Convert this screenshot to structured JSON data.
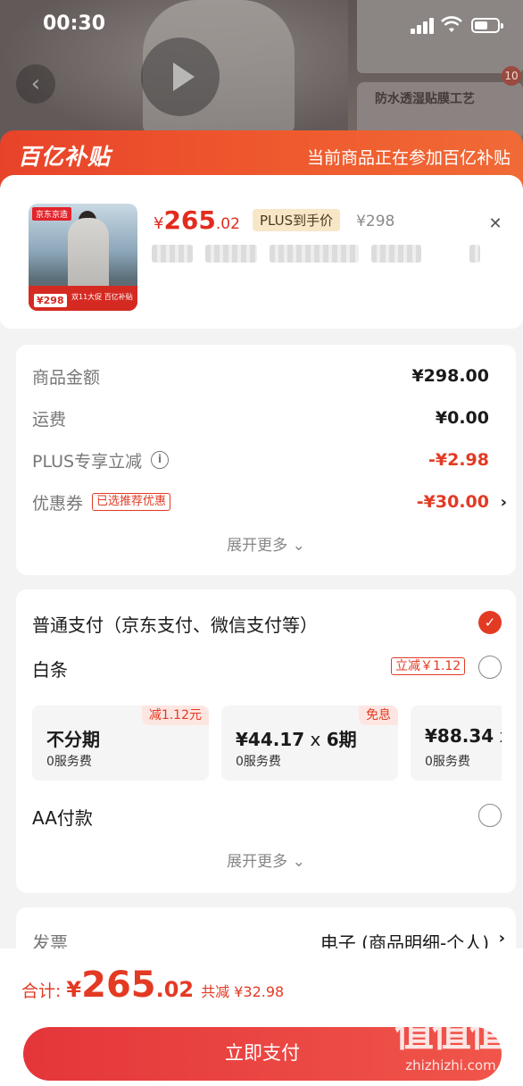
{
  "status_bar": {
    "time": "00:30"
  },
  "background_page": {
    "feature_text": "防水透湿贴膜工艺",
    "badge_count": "10"
  },
  "banner": {
    "logo": "百亿补贴",
    "text": "当前商品正在参加百亿补贴"
  },
  "product": {
    "image_store_tag": "京东京造",
    "image_price": "¥298",
    "image_promo": "双11大促 百亿补贴",
    "price_yen": "¥",
    "price_int": "265",
    "price_dec": ".02",
    "plus_tag": "PLUS到手价",
    "original_price": "¥298",
    "close_icon": "close-icon"
  },
  "amounts": {
    "goods_label": "商品金额",
    "goods_value": "¥298.00",
    "shipping_label": "运费",
    "shipping_value": "¥0.00",
    "plus_label": "PLUS专享立减",
    "plus_value": "-¥2.98",
    "coupon_label": "优惠券",
    "coupon_tag": "已选推荐优惠",
    "coupon_value": "-¥30.00",
    "expand_more": "展开更多"
  },
  "payment": {
    "normal_title": "普通支付（京东支付、微信支付等）",
    "baitiao_label": "白条",
    "baitiao_reduce": "立减￥1.12",
    "plans": [
      {
        "main": "不分期",
        "x": "",
        "periods": "",
        "sub": "0服务费",
        "badge": "减1.12元"
      },
      {
        "main": "¥44.17",
        "x": " x ",
        "periods": "6期",
        "sub": "0服务费",
        "badge": "免息"
      },
      {
        "main": "¥88.34",
        "x": " x",
        "periods": "",
        "sub": "0服务费",
        "badge": ""
      }
    ],
    "aa_label": "AA付款",
    "expand_more": "展开更多"
  },
  "invoice": {
    "label": "发票",
    "value": "电子 (商品明细-个人)"
  },
  "bottom": {
    "total_label": "合计:",
    "total_yen": "¥",
    "total_int": "265",
    "total_dec": ".02",
    "total_save": "共减 ¥32.98",
    "pay_button": "立即支付"
  },
  "watermark": {
    "logo": "值值值",
    "url": "zhizhizhi.com"
  },
  "colors": {
    "accent_red": "#e33a24",
    "banner_orange": "#ef5a2e",
    "plus_gold": "#f8e7c6"
  }
}
